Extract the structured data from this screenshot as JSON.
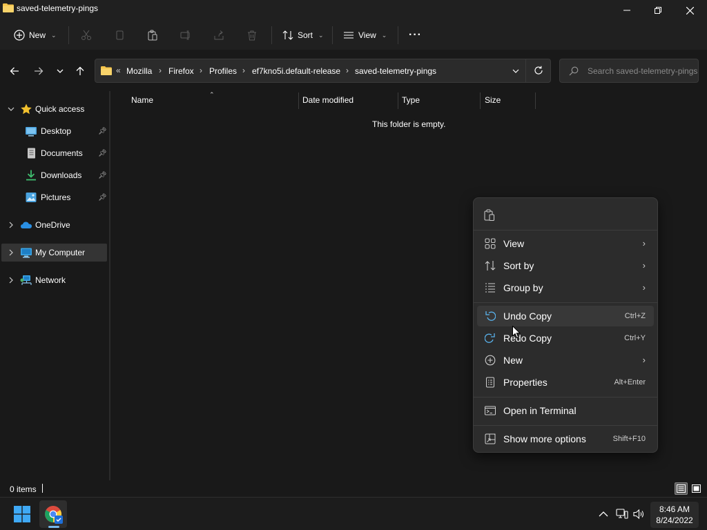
{
  "window": {
    "title": "saved-telemetry-pings"
  },
  "commandbar": {
    "new_label": "New",
    "sort_label": "Sort",
    "view_label": "View",
    "more_label": "···"
  },
  "address": {
    "overflow": "«",
    "crumbs": [
      "Mozilla",
      "Firefox",
      "Profiles",
      "ef7kno5i.default-release",
      "saved-telemetry-pings"
    ],
    "separator": "›",
    "search_placeholder": "Search saved-telemetry-pings"
  },
  "sidebar": {
    "items": [
      {
        "label": "Quick access"
      },
      {
        "label": "Desktop"
      },
      {
        "label": "Documents"
      },
      {
        "label": "Downloads"
      },
      {
        "label": "Pictures"
      },
      {
        "label": "OneDrive"
      },
      {
        "label": "My Computer"
      },
      {
        "label": "Network"
      }
    ]
  },
  "content": {
    "columns": [
      "Name",
      "Date modified",
      "Type",
      "Size"
    ],
    "empty_message": "This folder is empty."
  },
  "context_menu": {
    "items": [
      {
        "label": "View",
        "shortcut": ""
      },
      {
        "label": "Sort by",
        "shortcut": ""
      },
      {
        "label": "Group by",
        "shortcut": ""
      },
      {
        "label": "Undo Copy",
        "shortcut": "Ctrl+Z"
      },
      {
        "label": "Redo Copy",
        "shortcut": "Ctrl+Y"
      },
      {
        "label": "New",
        "shortcut": ""
      },
      {
        "label": "Properties",
        "shortcut": "Alt+Enter"
      },
      {
        "label": "Open in Terminal",
        "shortcut": ""
      },
      {
        "label": "Show more options",
        "shortcut": "Shift+F10"
      }
    ]
  },
  "statusbar": {
    "items_count": "0 items"
  },
  "taskbar": {
    "time": "8:46 AM",
    "date": "8/24/2022"
  },
  "colors": {
    "window_bg": "#191919",
    "menu_bg": "#2c2c2c",
    "folder_yellow": "#f4c44c",
    "accent_blue": "#4aa3df",
    "star_gold": "#f2c12e"
  }
}
